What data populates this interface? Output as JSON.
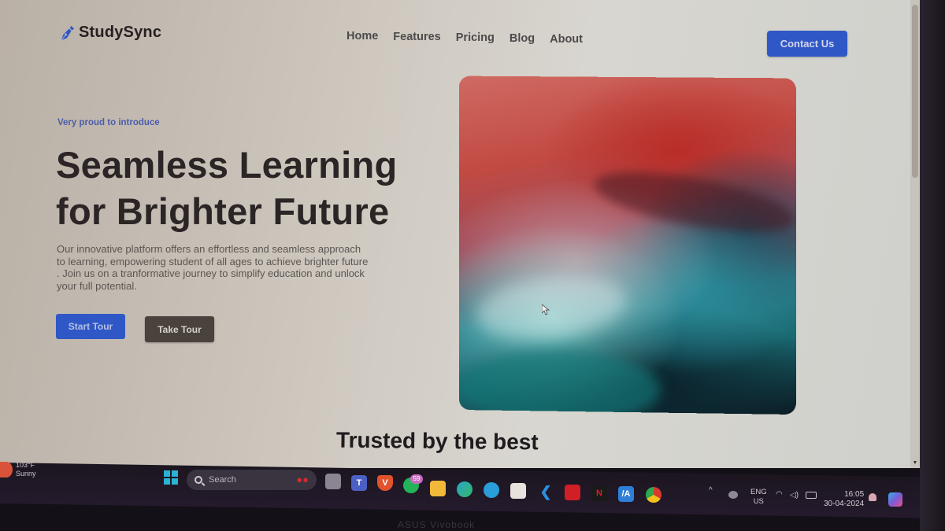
{
  "navbar": {
    "logo_text": "StudySync",
    "links": [
      "Home",
      "Features",
      "Pricing",
      "Blog",
      "About"
    ],
    "contact_label": "Contact Us"
  },
  "hero": {
    "eyebrow": "Very proud to introduce",
    "headline_line1": "Seamless Learning",
    "headline_line2": "for Brighter Future",
    "description": "Our innovative platform offers an effortless and seamless approach to learning, empowering student of all ages to achieve brighter future . Join us on a tranformative journey to simplify education and unlock your full potential.",
    "start_tour_label": "Start Tour",
    "take_tour_label": "Take Tour",
    "image_icon": "fluid-art-image"
  },
  "trusted": {
    "title": "Trusted by the best"
  },
  "colors": {
    "primary": "#2f58c6",
    "dark_button": "#4a423d",
    "heading": "#2b2526",
    "eyebrow": "#4c5dab"
  },
  "taskbar": {
    "weather_temp": "103°F",
    "weather_desc": "Sunny",
    "search_placeholder": "Search",
    "apps": [
      {
        "name": "task-view",
        "icon": "task-view-icon"
      },
      {
        "name": "teams",
        "icon": "teams-icon"
      },
      {
        "name": "brave",
        "icon": "brave-icon"
      },
      {
        "name": "whatsapp",
        "icon": "whatsapp-icon",
        "badge": "59"
      },
      {
        "name": "file-explorer",
        "icon": "folder-icon"
      },
      {
        "name": "edge",
        "icon": "edge-icon"
      },
      {
        "name": "telegram",
        "icon": "telegram-icon"
      },
      {
        "name": "microsoft-store",
        "icon": "store-icon"
      },
      {
        "name": "vscode",
        "icon": "vscode-icon"
      },
      {
        "name": "mcafee",
        "icon": "mcafee-icon"
      },
      {
        "name": "netflix",
        "icon": "netflix-icon"
      },
      {
        "name": "myasus",
        "icon": "myasus-icon"
      },
      {
        "name": "chrome",
        "icon": "chrome-icon"
      }
    ],
    "language_line1": "ENG",
    "language_line2": "US",
    "time": "16:05",
    "date": "30-04-2024"
  },
  "device": {
    "brand": "ASUS Vivobook"
  }
}
